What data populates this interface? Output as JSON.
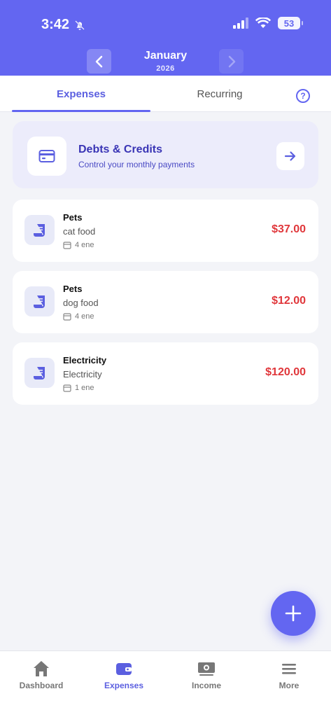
{
  "status_bar": {
    "time": "3:42",
    "battery": "53"
  },
  "header": {
    "month": "January",
    "year": "2026"
  },
  "tabs": {
    "expenses": "Expenses",
    "recurring": "Recurring",
    "help": "?"
  },
  "debts": {
    "title": "Debts & Credits",
    "subtitle": "Control your monthly payments"
  },
  "expenses": [
    {
      "category": "Pets",
      "description": "cat food",
      "date": "4 ene",
      "amount": "$37.00"
    },
    {
      "category": "Pets",
      "description": "dog food",
      "date": "4 ene",
      "amount": "$12.00"
    },
    {
      "category": "Electricity",
      "description": "Electricity",
      "date": "1 ene",
      "amount": "$120.00"
    }
  ],
  "bottom_nav": [
    {
      "label": "Dashboard",
      "icon": "home-icon"
    },
    {
      "label": "Expenses",
      "icon": "wallet-icon",
      "active": true
    },
    {
      "label": "Income",
      "icon": "money-icon"
    },
    {
      "label": "More",
      "icon": "menu-icon"
    }
  ],
  "colors": {
    "accent": "#6366f1",
    "amount": "#e0373b"
  }
}
